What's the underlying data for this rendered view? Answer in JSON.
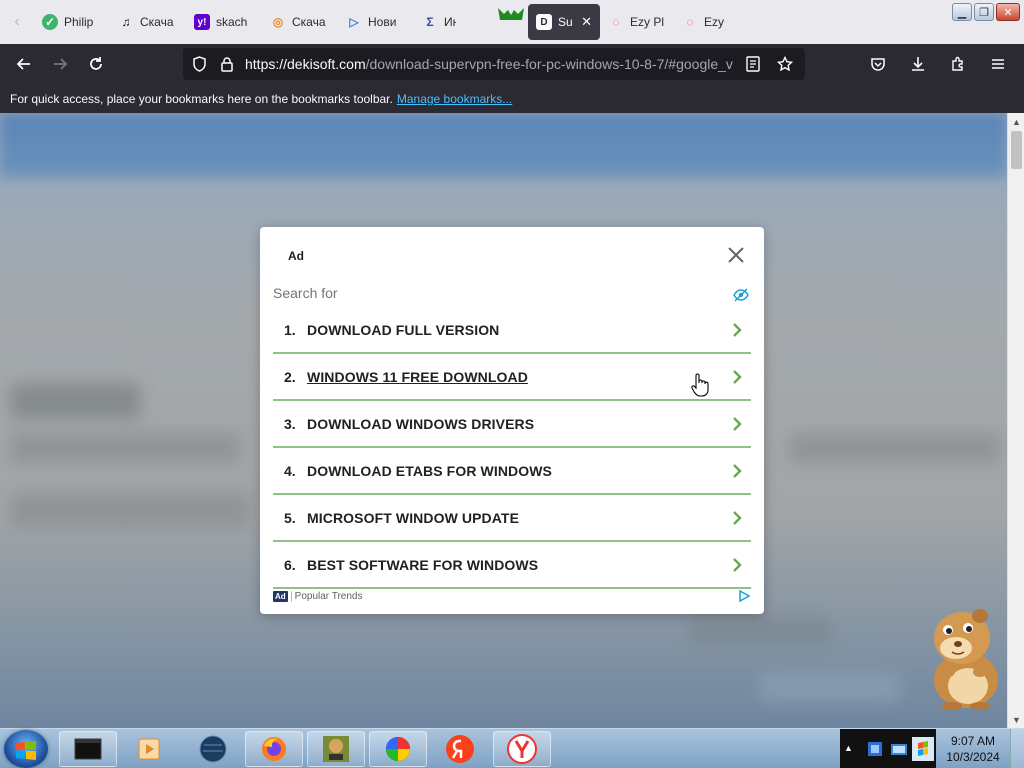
{
  "browser": {
    "tabs": [
      {
        "label": "Philip",
        "icon": "green-circle-icon"
      },
      {
        "label": "Скача",
        "icon": "music-note-icon"
      },
      {
        "label": "skach",
        "icon": "yahoo-icon"
      },
      {
        "label": "Скача",
        "icon": "orange-swirl-icon"
      },
      {
        "label": "Нови",
        "icon": "play-circle-icon"
      },
      {
        "label": "Ин",
        "icon": "sigma-icon"
      },
      {
        "label": "",
        "icon": "blank-icon"
      },
      {
        "label": "Sup",
        "icon": "dekisoft-icon",
        "active": true
      },
      {
        "label": "Ezy Pl",
        "icon": "ezy-icon"
      },
      {
        "label": "Ezy Pl",
        "icon": "ezy-icon"
      }
    ],
    "url_host": "https://dekisoft.com",
    "url_path": "/download-supervpn-free-for-pc-windows-10-8-7/#google_v",
    "bookmarks_text": "For quick access, place your bookmarks here on the bookmarks toolbar.",
    "bookmarks_link": "Manage bookmarks..."
  },
  "ad": {
    "ad_label": "Ad",
    "search_for": "Search for",
    "items": [
      {
        "num": "1.",
        "label": "DOWNLOAD FULL VERSION"
      },
      {
        "num": "2.",
        "label": "WINDOWS 11 FREE DOWNLOAD"
      },
      {
        "num": "3.",
        "label": "DOWNLOAD WINDOWS DRIVERS"
      },
      {
        "num": "4.",
        "label": "DOWNLOAD ETABS FOR WINDOWS"
      },
      {
        "num": "5.",
        "label": "MICROSOFT WINDOW UPDATE"
      },
      {
        "num": "6.",
        "label": "BEST SOFTWARE FOR WINDOWS"
      }
    ],
    "footer_badge": "Ad",
    "footer_text": "Popular Trends",
    "divider_color": "#8fc383",
    "chevron_color": "#6aa84f"
  },
  "taskbar": {
    "time": "9:07 AM",
    "date": "10/3/2024",
    "apps": [
      "terminal-icon",
      "media-player-icon",
      "globe-icon",
      "firefox-icon",
      "box-game-icon",
      "color-wheel-icon",
      "yandex-browser-icon",
      "yandex-icon"
    ]
  }
}
